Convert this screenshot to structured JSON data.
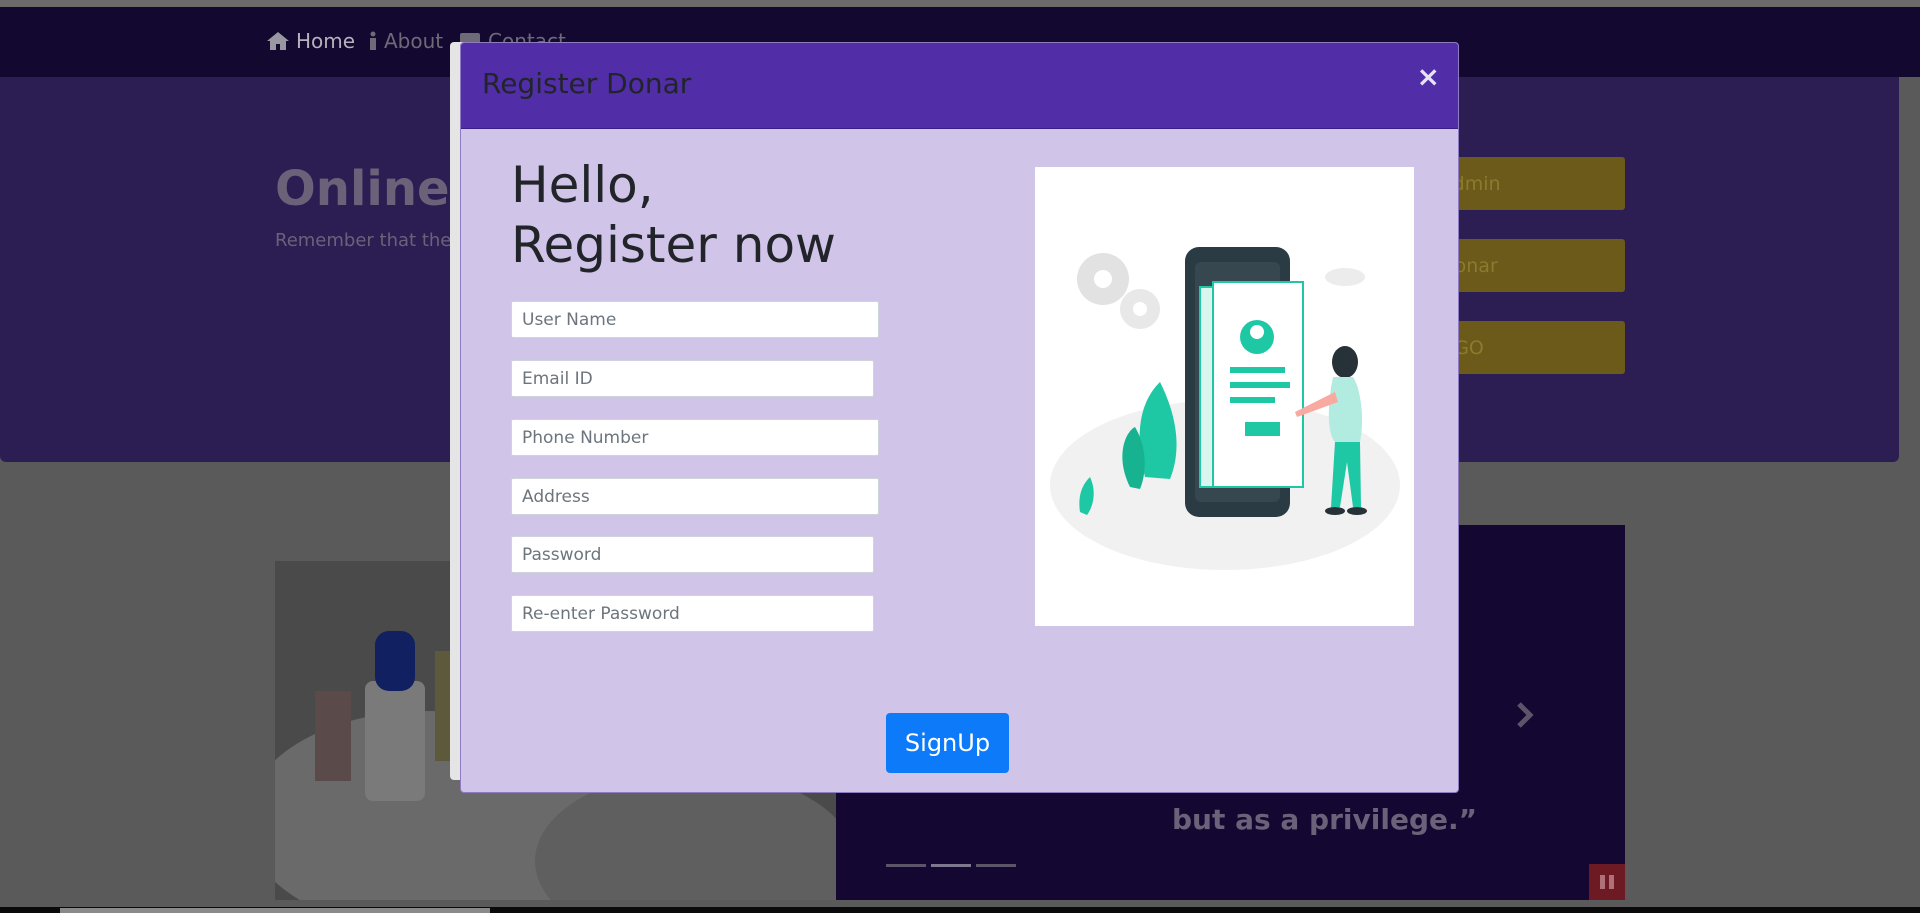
{
  "nav": {
    "home": "Home",
    "about": "About",
    "contact": "Contact"
  },
  "hero": {
    "title": "Online U",
    "subtitle": "Remember that the"
  },
  "side_buttons": {
    "admin": "Admin",
    "donar": "Donar",
    "ngo": "NGO"
  },
  "carousel": {
    "quote": "but as a privilege.”"
  },
  "modal": {
    "title": "Register Donar",
    "close": "×",
    "greeting_line1": "Hello,",
    "greeting_line2": "Register now",
    "fields": {
      "username_placeholder": "User Name",
      "email_placeholder": "Email ID",
      "phone_placeholder": "Phone Number",
      "address_placeholder": "Address",
      "password_placeholder": "Password",
      "repassword_placeholder": "Re-enter Password"
    },
    "signup_label": "SignUp"
  },
  "colors": {
    "modal_header": "#512da8",
    "modal_body": "#d1c4e9",
    "signup_button": "#0d7bf9",
    "illustration_accent": "#1ec8a5"
  },
  "icons": [
    "home-icon",
    "info-icon",
    "contact-icon",
    "chevron-right-icon",
    "pause-icon"
  ]
}
